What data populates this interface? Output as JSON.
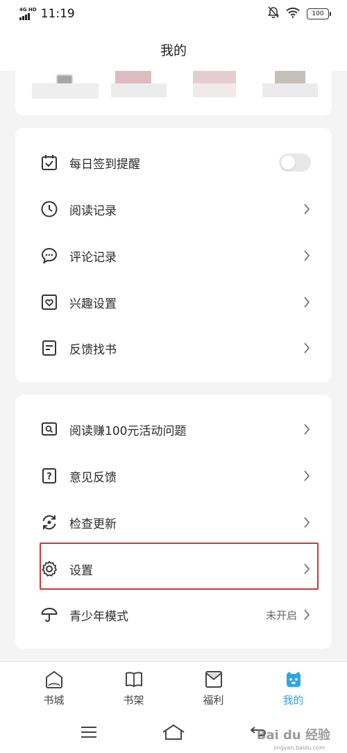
{
  "status_bar": {
    "network": "4G HD",
    "time": "11:19",
    "battery": "100"
  },
  "header": {
    "title": "我的"
  },
  "menu_group_1": [
    {
      "label": "每日签到提醒",
      "icon": "calendar-check-icon",
      "control": "toggle",
      "toggle_on": false
    },
    {
      "label": "阅读记录",
      "icon": "clock-icon",
      "control": "chevron"
    },
    {
      "label": "评论记录",
      "icon": "comment-icon",
      "control": "chevron"
    },
    {
      "label": "兴趣设置",
      "icon": "heart-box-icon",
      "control": "chevron"
    },
    {
      "label": "反馈找书",
      "icon": "document-icon",
      "control": "chevron"
    }
  ],
  "menu_group_2": [
    {
      "label": "阅读赚100元活动问题",
      "icon": "search-screen-icon",
      "control": "chevron"
    },
    {
      "label": "意见反馈",
      "icon": "question-box-icon",
      "control": "chevron"
    },
    {
      "label": "检查更新",
      "icon": "refresh-icon",
      "control": "chevron"
    },
    {
      "label": "设置",
      "icon": "gear-icon",
      "control": "chevron",
      "highlighted": true
    },
    {
      "label": "青少年模式",
      "icon": "umbrella-icon",
      "control": "chevron",
      "status": "未开启"
    }
  ],
  "bottom_nav": [
    {
      "label": "书城",
      "icon": "bookstore-icon",
      "active": false
    },
    {
      "label": "书架",
      "icon": "bookshelf-icon",
      "active": false
    },
    {
      "label": "福利",
      "icon": "gift-envelope-icon",
      "active": false
    },
    {
      "label": "我的",
      "icon": "profile-mascot-icon",
      "active": true
    }
  ],
  "watermark": {
    "brand": "Bai du 经验",
    "sub": "jingyan.baidu.com"
  },
  "colors": {
    "accent": "#2ea6e6",
    "highlight": "#d8312f"
  }
}
